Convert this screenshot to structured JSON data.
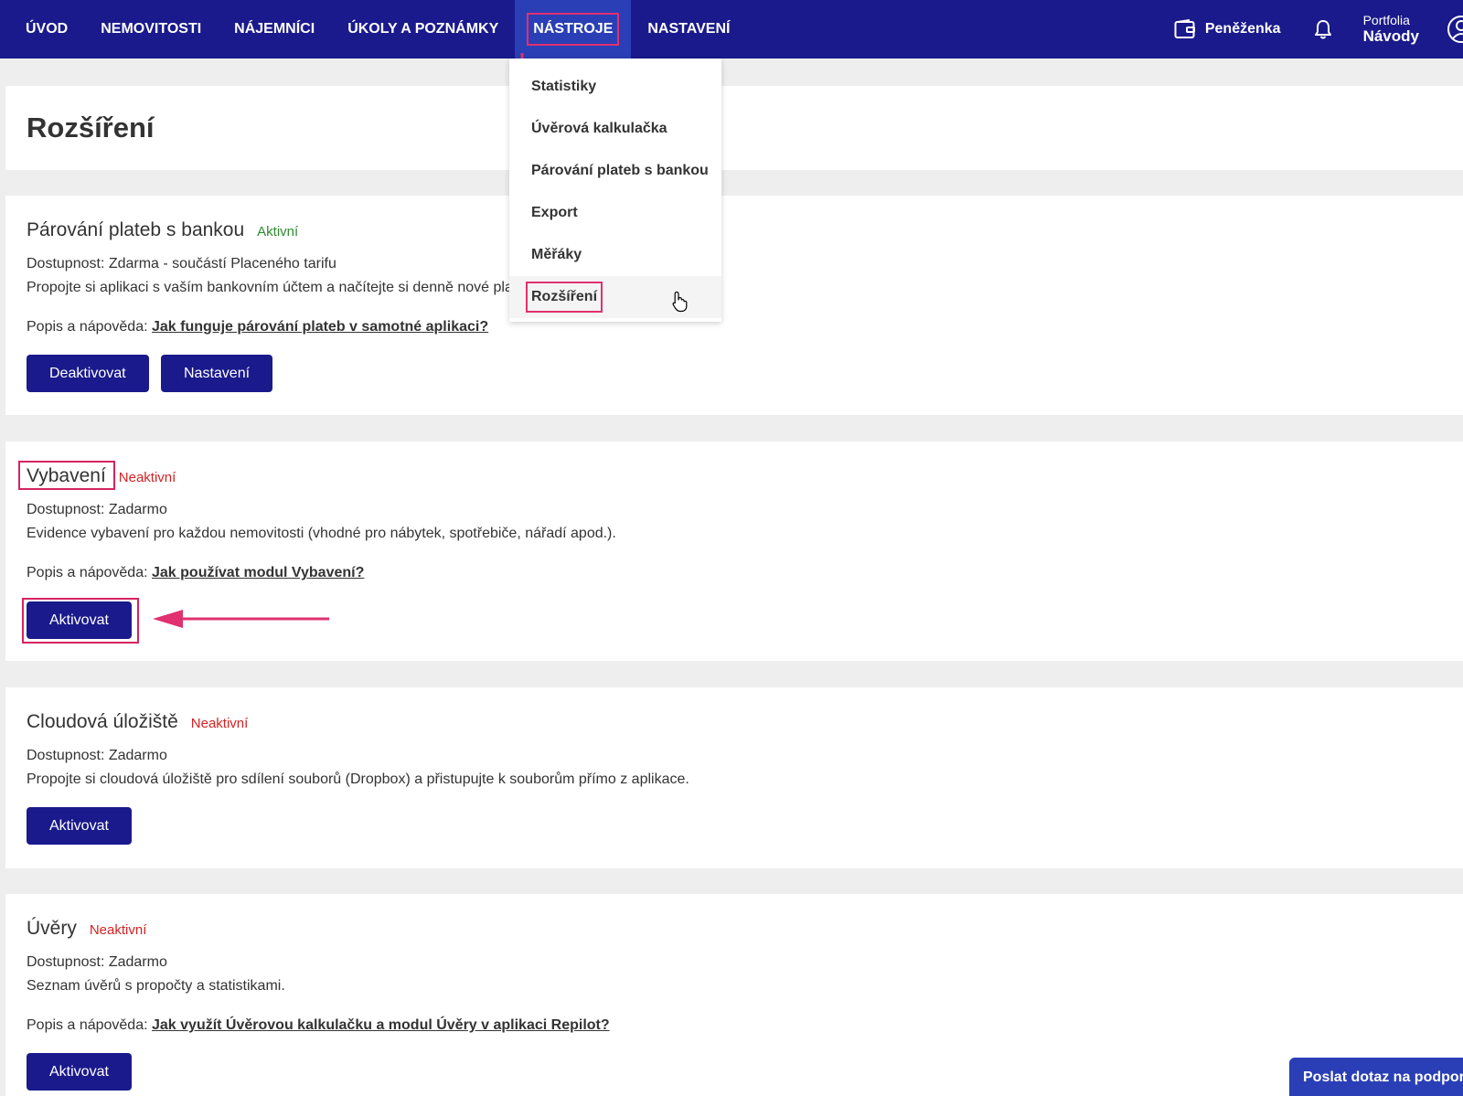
{
  "nav": {
    "items": [
      {
        "label": "ÚVOD"
      },
      {
        "label": "NEMOVITOSTI"
      },
      {
        "label": "NÁJEMNÍCI"
      },
      {
        "label": "ÚKOLY A POZNÁMKY"
      },
      {
        "label": "NÁSTROJE"
      },
      {
        "label": "NASTAVENÍ"
      }
    ],
    "active_index": 4,
    "wallet_label": "Peněženka",
    "portfolio_label": "Portfolia",
    "portfolio_value": "Návody"
  },
  "tools_menu": {
    "items": [
      {
        "label": "Statistiky"
      },
      {
        "label": "Úvěrová kalkulačka"
      },
      {
        "label": "Párování plateb s bankou"
      },
      {
        "label": "Export"
      },
      {
        "label": "Měřáky"
      },
      {
        "label": "Rozšíření"
      }
    ],
    "highlighted_index": 5
  },
  "page": {
    "title": "Rozšíření"
  },
  "extensions": [
    {
      "title": "Párování plateb s bankou",
      "status": "Aktivní",
      "availability": "Dostupnost: Zdarma - součástí Placeného tarifu",
      "description": "Propojte si aplikaci s vaším bankovním účtem a načítejte si denně nové platby.",
      "help_prefix": "Popis a nápověda:",
      "help_link": "Jak funguje párování plateb v samotné aplikaci?",
      "buttons": [
        "Deaktivovat",
        "Nastavení"
      ]
    },
    {
      "title": "Vybavení",
      "status": "Neaktivní",
      "availability": "Dostupnost: Zadarmo",
      "description": "Evidence vybavení pro každou nemovitosti (vhodné pro nábytek, spotřebiče, nářadí apod.).",
      "help_prefix": "Popis a nápověda:",
      "help_link": "Jak používat modul Vybavení?",
      "buttons": [
        "Aktivovat"
      ]
    },
    {
      "title": "Cloudová úložiště",
      "status": "Neaktivní",
      "availability": "Dostupnost: Zadarmo",
      "description": "Propojte si cloudová úložiště pro sdílení souborů (Dropbox) a přistupujte k souborům přímo z aplikace.",
      "buttons": [
        "Aktivovat"
      ]
    },
    {
      "title": "Úvěry",
      "status": "Neaktivní",
      "availability": "Dostupnost: Zadarmo",
      "description": "Seznam úvěrů s propočty a statistikami.",
      "help_prefix": "Popis a nápověda:",
      "help_link": "Jak využít Úvěrovou kalkulačku a modul Úvěry v aplikaci Repilot?",
      "buttons": [
        "Aktivovat"
      ]
    }
  ],
  "support_button": "Poslat dotaz na podporu",
  "colors": {
    "nav_bg": "#1a1a8c",
    "nav_active_bg": "#2a3fb5",
    "button_bg": "#1a1a8c",
    "status_active": "#2e8b2e",
    "status_inactive": "#d32222",
    "annotation": "#e0306f"
  }
}
